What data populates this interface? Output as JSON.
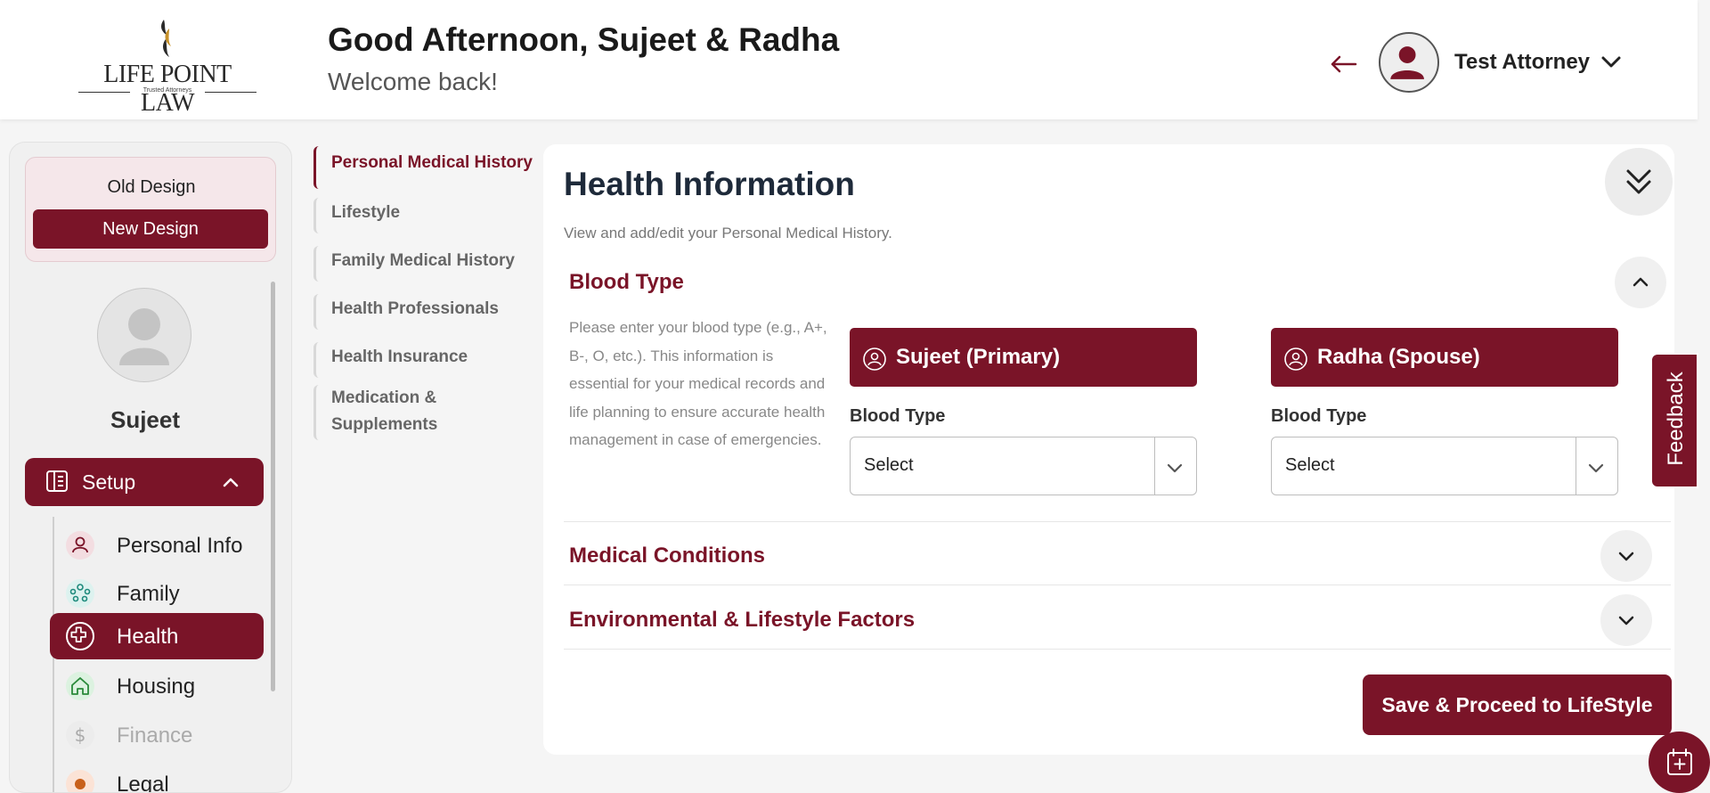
{
  "header": {
    "logo_name": "LIFE POINT LAW",
    "logo_tagline": "Trusted Attorneys",
    "greeting": "Good Afternoon, Sujeet & Radha",
    "welcome": "Welcome back!",
    "user_name": "Test Attorney"
  },
  "sidebar": {
    "old_design": "Old Design",
    "new_design": "New Design",
    "profile_name": "Sujeet",
    "setup_label": "Setup",
    "items": [
      {
        "label": "Personal Info",
        "state": "normal"
      },
      {
        "label": "Family",
        "state": "normal"
      },
      {
        "label": "Health",
        "state": "active"
      },
      {
        "label": "Housing",
        "state": "normal"
      },
      {
        "label": "Finance",
        "state": "disabled"
      },
      {
        "label": "Legal",
        "state": "normal"
      }
    ]
  },
  "subnav": {
    "items": [
      {
        "label": "Personal Medical History",
        "active": true
      },
      {
        "label": "Lifestyle",
        "active": false
      },
      {
        "label": "Family Medical History",
        "active": false
      },
      {
        "label": "Health Professionals",
        "active": false
      },
      {
        "label": "Health Insurance",
        "active": false
      },
      {
        "label": "Medication & Supplements",
        "active": false
      }
    ]
  },
  "main": {
    "title": "Health Information",
    "subtitle": "View and add/edit your Personal Medical History.",
    "sections": [
      {
        "title": "Blood Type",
        "expanded": true
      },
      {
        "title": "Medical Conditions",
        "expanded": false
      },
      {
        "title": "Environmental & Lifestyle Factors",
        "expanded": false
      }
    ],
    "blood_type": {
      "description": "Please enter your blood type (e.g., A+, B-, O, etc.). This information is essential for your medical records and life planning to ensure accurate health management in case of emergencies.",
      "primary": {
        "name": "Sujeet (Primary)",
        "field_label": "Blood Type",
        "value": "Select"
      },
      "spouse": {
        "name": "Radha (Spouse)",
        "field_label": "Blood Type",
        "value": "Select"
      }
    },
    "save_button": "Save & Proceed to LifeStyle"
  },
  "feedback_label": "Feedback",
  "colors": {
    "brand": "#7a1428",
    "logo_gold": "#c8922a"
  }
}
